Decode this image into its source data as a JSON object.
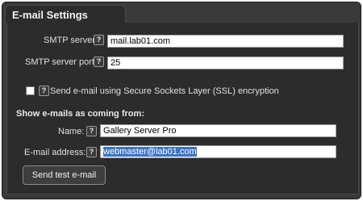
{
  "window": {
    "title": "E-mail Settings"
  },
  "smtp": {
    "server_label": "SMTP server:",
    "server_value": "mail.lab01.com",
    "port_label": "SMTP server port:",
    "port_value": "25",
    "ssl_label": "Send e-mail using Secure Sockets Layer (SSL) encryption",
    "ssl_checked": false
  },
  "sender": {
    "section_title": "Show e-mails as coming from:",
    "name_label": "Name:",
    "name_value": "Gallery Server Pro",
    "email_label": "E-mail address:",
    "email_value": "webmaster@lab01.com"
  },
  "actions": {
    "send_test_label": "Send test e-mail"
  },
  "icons": {
    "help": "help-icon",
    "help_glyph": "?"
  },
  "colors": {
    "background": "#2c2c2c",
    "selection": "#3b73c6"
  }
}
